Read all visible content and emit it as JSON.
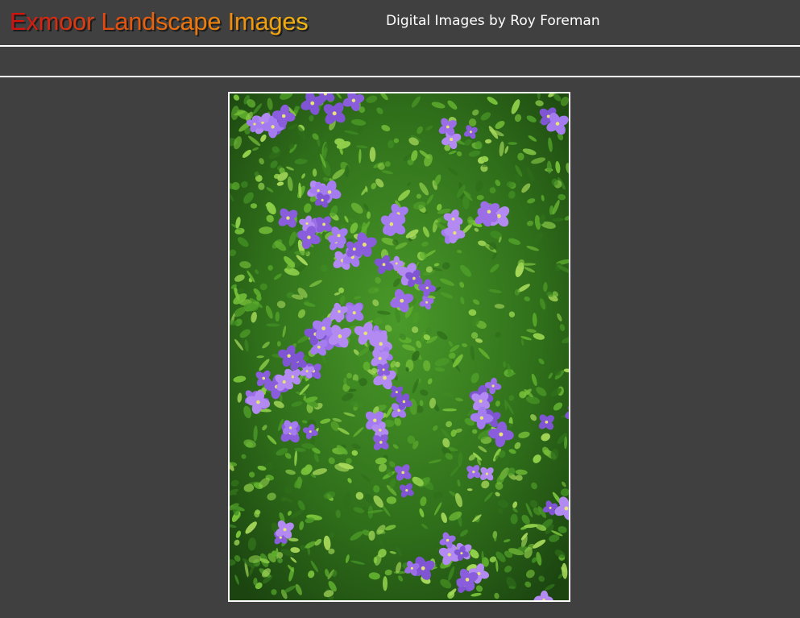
{
  "header": {
    "site_title": "Exmoor Landscape Images",
    "tagline": "Digital Images by Roy Foreman"
  },
  "colors": {
    "background": "#404040",
    "divider": "#ffffff",
    "title_gradient": [
      "#d10f0f",
      "#ee7d0c",
      "#f3b70f"
    ],
    "flower": "#9b6ee8",
    "foliage": "#3f8a23"
  },
  "photo": {
    "subject": "purple-flowers-among-green-foliage"
  }
}
